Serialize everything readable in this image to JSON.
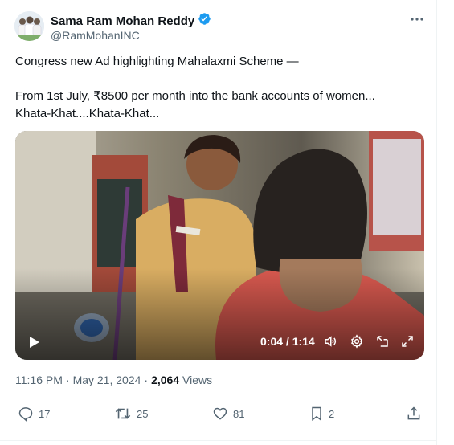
{
  "author": {
    "display_name": "Sama Ram Mohan Reddy",
    "handle": "@RamMohanINC"
  },
  "tweet": {
    "line1": "Congress new Ad highlighting Mahalaxmi Scheme —",
    "line2": "From 1st July, ₹8500 per month into the bank accounts of women...",
    "line3": "Khata-Khat....Khata-Khat..."
  },
  "video": {
    "time_display": "0:04 / 1:14",
    "progress": 0.054
  },
  "meta": {
    "time": "11:16 PM",
    "separator": "·",
    "date": "May 21, 2024",
    "views_count": "2,064",
    "views_label": "Views"
  },
  "actions": {
    "replies": "17",
    "retweets": "25",
    "likes": "81",
    "bookmarks": "2"
  },
  "colors": {
    "verified": "#1d9bf0",
    "text_secondary": "#536471"
  }
}
